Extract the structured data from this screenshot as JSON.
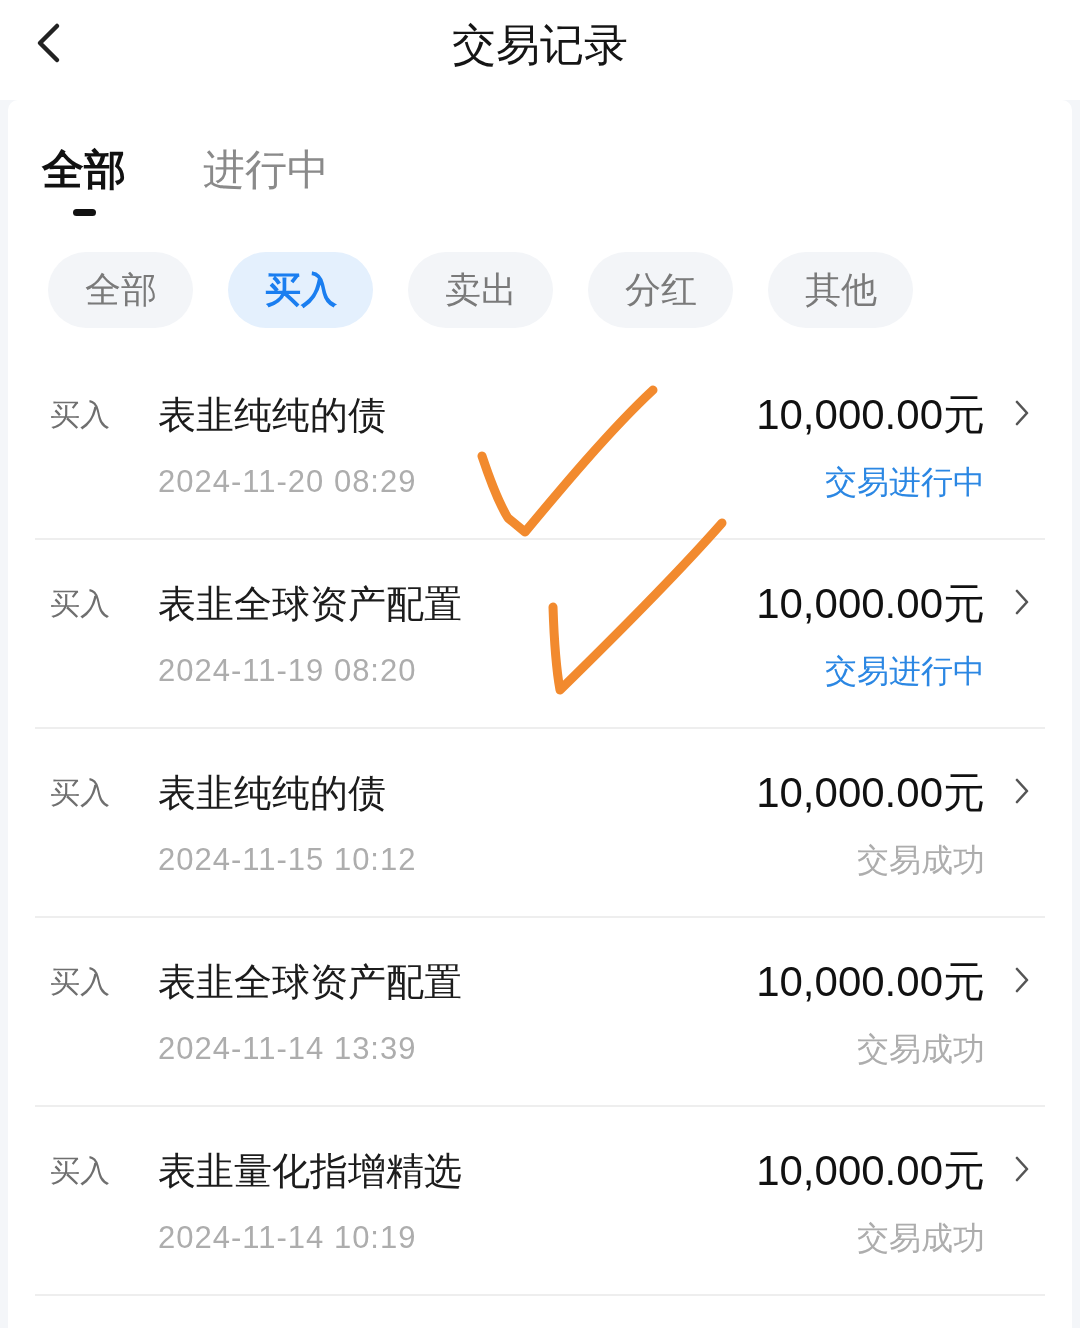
{
  "header": {
    "title": "交易记录"
  },
  "tabs": [
    {
      "label": "全部",
      "selected": true
    },
    {
      "label": "进行中",
      "selected": false
    }
  ],
  "filters": [
    {
      "label": "全部",
      "selected": false
    },
    {
      "label": "买入",
      "selected": true
    },
    {
      "label": "卖出",
      "selected": false
    },
    {
      "label": "分红",
      "selected": false
    },
    {
      "label": "其他",
      "selected": false
    }
  ],
  "transactions": [
    {
      "type": "买入",
      "name": "表韭纯纯的债",
      "time": "2024-11-20 08:29",
      "amount": "10,000.00元",
      "status": "交易进行中",
      "in_progress": true,
      "hand_ticked": true
    },
    {
      "type": "买入",
      "name": "表韭全球资产配置",
      "time": "2024-11-19 08:20",
      "amount": "10,000.00元",
      "status": "交易进行中",
      "in_progress": true,
      "hand_ticked": true
    },
    {
      "type": "买入",
      "name": "表韭纯纯的债",
      "time": "2024-11-15 10:12",
      "amount": "10,000.00元",
      "status": "交易成功",
      "in_progress": false,
      "hand_ticked": false
    },
    {
      "type": "买入",
      "name": "表韭全球资产配置",
      "time": "2024-11-14 13:39",
      "amount": "10,000.00元",
      "status": "交易成功",
      "in_progress": false,
      "hand_ticked": false
    },
    {
      "type": "买入",
      "name": "表韭量化指增精选",
      "time": "2024-11-14 10:19",
      "amount": "10,000.00元",
      "status": "交易成功",
      "in_progress": false,
      "hand_ticked": false
    }
  ]
}
